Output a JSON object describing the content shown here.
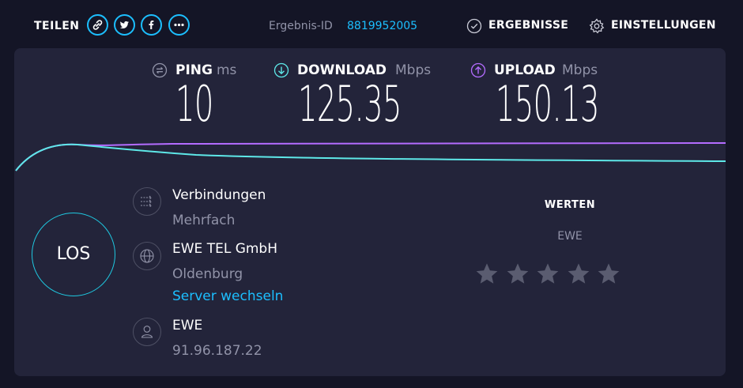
{
  "header": {
    "share_label": "TEILEN",
    "share_icons": [
      "link-icon",
      "twitter-icon",
      "facebook-icon",
      "more-icon"
    ],
    "result_label": "Ergebnis-ID",
    "result_id": "8819952005",
    "results_label": "ERGEBNISSE",
    "settings_label": "EINSTELLUNGEN"
  },
  "metrics": {
    "ping": {
      "label": "PING",
      "unit": "ms",
      "value": "10"
    },
    "download": {
      "label": "DOWNLOAD",
      "unit": "Mbps",
      "value": "125.35"
    },
    "upload": {
      "label": "UPLOAD",
      "unit": "Mbps",
      "value": "150.13"
    }
  },
  "start_button": {
    "label": "LOS"
  },
  "connections": {
    "title": "Verbindungen",
    "value": "Mehrfach"
  },
  "server": {
    "name": "EWE TEL GmbH",
    "location": "Oldenburg",
    "change_link": "Server wechseln"
  },
  "provider": {
    "name": "EWE",
    "ip": "91.96.187.22"
  },
  "rating": {
    "title": "WERTEN",
    "provider": "EWE",
    "stars": 5,
    "selected": 0
  },
  "colors": {
    "accent": "#1cbfff",
    "download": "#5ee8e8",
    "upload": "#b46cff",
    "panel": "#23243a",
    "background": "#141526",
    "muted": "#9193a8",
    "star": "#5a5c70"
  }
}
